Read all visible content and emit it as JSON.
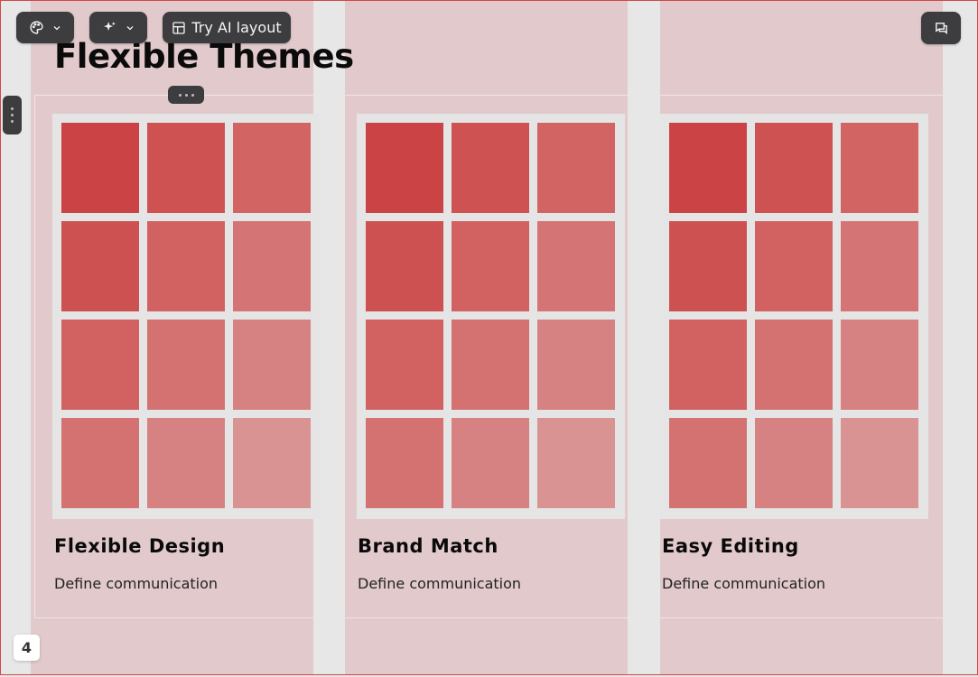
{
  "toolbar": {
    "theme_icon": "palette-icon",
    "ai_icon": "sparkle-icon",
    "layout_icon": "layout-icon",
    "ai_layout_label": "Try AI layout",
    "comment_icon": "comment-icon"
  },
  "slide": {
    "title": "Flexible Themes",
    "page_number": "4",
    "cards": [
      {
        "title": "Flexible Design",
        "description": "Define communication"
      },
      {
        "title": "Brand Match",
        "description": "Define communication"
      },
      {
        "title": "Easy Editing",
        "description": "Define communication"
      }
    ],
    "swatch_colors": [
      [
        "#cb4345",
        "#cf5253",
        "#d36464"
      ],
      [
        "#ce5152",
        "#d26261",
        "#d47474"
      ],
      [
        "#d26262",
        "#d47272",
        "#d78282"
      ],
      [
        "#d47272",
        "#d68282",
        "#d99393"
      ]
    ]
  },
  "colors": {
    "accent": "#d04848",
    "toolbar_bg": "#3d3d3f",
    "guide": "#e2cacc"
  }
}
